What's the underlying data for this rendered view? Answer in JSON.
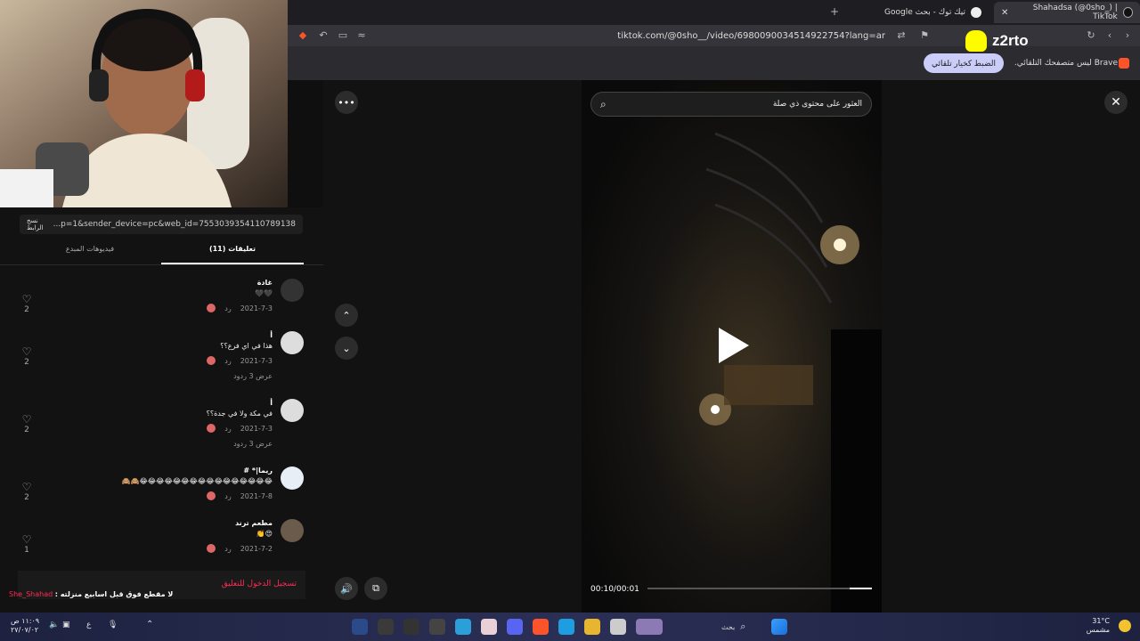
{
  "tabs": [
    {
      "title": "Shahadsa (@0sho_) | TikTok",
      "active": true
    },
    {
      "title": "تيك توك - بحث Google",
      "active": false
    }
  ],
  "toolbar": {
    "url": "tiktok.com/@0sho__/video/6980090034514922754?lang=ar",
    "new_tab_label": "+"
  },
  "infobar": {
    "message": "Brave ليس متصفحك التلقائي.",
    "button_label": "الضبط كخيار تلقائي"
  },
  "snap": {
    "username": "z2rto"
  },
  "panel": {
    "share_url": "...p=1&sender_device=pc&web_id=7553039354110789138",
    "copy_link_label": "نسخ الرابط",
    "tabs": [
      {
        "label": "تعليقات (11)",
        "active": true
      },
      {
        "label": "فيديوهات المبدع",
        "active": false
      }
    ]
  },
  "comments": [
    {
      "user": "غادة",
      "text": "🖤🖤",
      "date": "2021-7-3",
      "reply": "رد",
      "likes": "2",
      "replies": ""
    },
    {
      "user": "أ",
      "text": "هذا في اي فرع؟؟",
      "date": "2021-7-3",
      "reply": "رد",
      "likes": "2",
      "replies": "عرض 3 ردود"
    },
    {
      "user": "أ",
      "text": "في مكة ولا في جدة؟؟",
      "date": "2021-7-3",
      "reply": "رد",
      "likes": "2",
      "replies": "عرض 3 ردود"
    },
    {
      "user": "ريما|* #",
      "text": "😂😂😂😂😂😂😂😂😂😂😂😂😂😂😂😂🙈🙈",
      "date": "2021-7-8",
      "reply": "رد",
      "likes": "2",
      "replies": ""
    },
    {
      "user": "مطعم ترند",
      "text": "😍👏",
      "date": "2021-7-2",
      "reply": "رد",
      "likes": "1",
      "replies": ""
    }
  ],
  "login_cta": "تسجيل الدخول للتعليق",
  "chat": {
    "user": "She_Shahad",
    "message": ": لا مقطع فوق قبل اسابيع منزلته"
  },
  "video": {
    "search_placeholder": "العثور على محتوى ذي صلة",
    "timecode": "00:10/00:01",
    "progress": 0.1
  },
  "taskbar": {
    "time": "١١:٠٩ ص",
    "date": "٢٧/٠٧/٠٢",
    "weather_temp": "31°C",
    "weather_desc": "مشمس",
    "search_label": "بحث",
    "lang": "ع"
  },
  "colors": {
    "accent": "#fe2c55",
    "autoplay_button": "#c9cdf7",
    "snap": "#fffc00"
  }
}
